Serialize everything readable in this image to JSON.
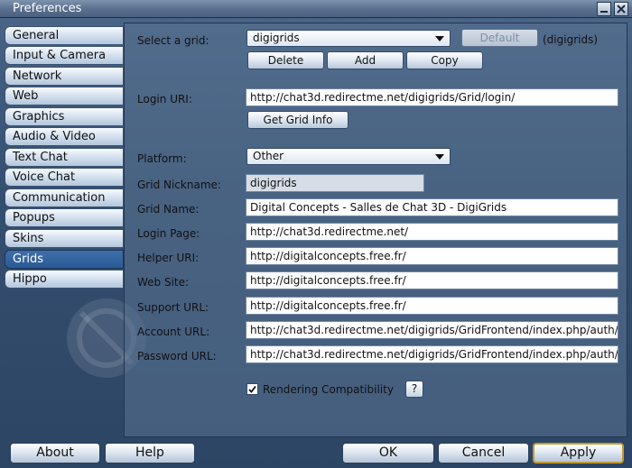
{
  "window": {
    "title": "Preferences"
  },
  "sidebar": {
    "tabs": [
      {
        "label": "General"
      },
      {
        "label": "Input & Camera"
      },
      {
        "label": "Network"
      },
      {
        "label": "Web"
      },
      {
        "label": "Graphics"
      },
      {
        "label": "Audio & Video"
      },
      {
        "label": "Text Chat"
      },
      {
        "label": "Voice Chat"
      },
      {
        "label": "Communication"
      },
      {
        "label": "Popups"
      },
      {
        "label": "Skins"
      },
      {
        "label": "Grids"
      },
      {
        "label": "Hippo"
      }
    ],
    "active": "Grids"
  },
  "grids": {
    "select_label": "Select a grid:",
    "selected_grid": "digigrids",
    "default_button": "Default",
    "default_grid_note": "(digigrids)",
    "delete_button": "Delete",
    "add_button": "Add",
    "copy_button": "Copy",
    "login_uri_label": "Login URI:",
    "login_uri": "http://chat3d.redirectme.net/digigrids/Grid/login/",
    "get_grid_info_button": "Get Grid Info",
    "platform_label": "Platform:",
    "platform_value": "Other",
    "nickname_label": "Grid Nickname:",
    "nickname": "digigrids",
    "grid_name_label": "Grid Name:",
    "grid_name": "Digital Concepts - Salles de Chat 3D - DigiGrids",
    "login_page_label": "Login Page:",
    "login_page": "http://chat3d.redirectme.net/",
    "helper_uri_label": "Helper URI:",
    "helper_uri": "http://digitalconcepts.free.fr/",
    "website_label": "Web Site:",
    "website": "http://digitalconcepts.free.fr/",
    "support_url_label": "Support URL:",
    "support_url": "http://digitalconcepts.free.fr/",
    "account_url_label": "Account URL:",
    "account_url": "http://chat3d.redirectme.net/digigrids/GridFrontend/index.php/auth/",
    "password_url_label": "Password URL:",
    "password_url": "http://chat3d.redirectme.net/digigrids/GridFrontend/index.php/auth/",
    "rendering_compat_label": "Rendering Compatibility",
    "rendering_compat_checked": true,
    "help_button": "?"
  },
  "footer": {
    "about_button": "About",
    "help_button": "Help",
    "ok_button": "OK",
    "cancel_button": "Cancel",
    "apply_button": "Apply"
  },
  "colors": {
    "background": "#354f70",
    "active_tab": "#2a5a96",
    "default_button_border": "#c39a2e"
  },
  "icons": {
    "minimize": "minimize-icon",
    "close": "close-icon",
    "dropdown": "chevron-down-icon",
    "checkbox": "checkmark-icon"
  }
}
